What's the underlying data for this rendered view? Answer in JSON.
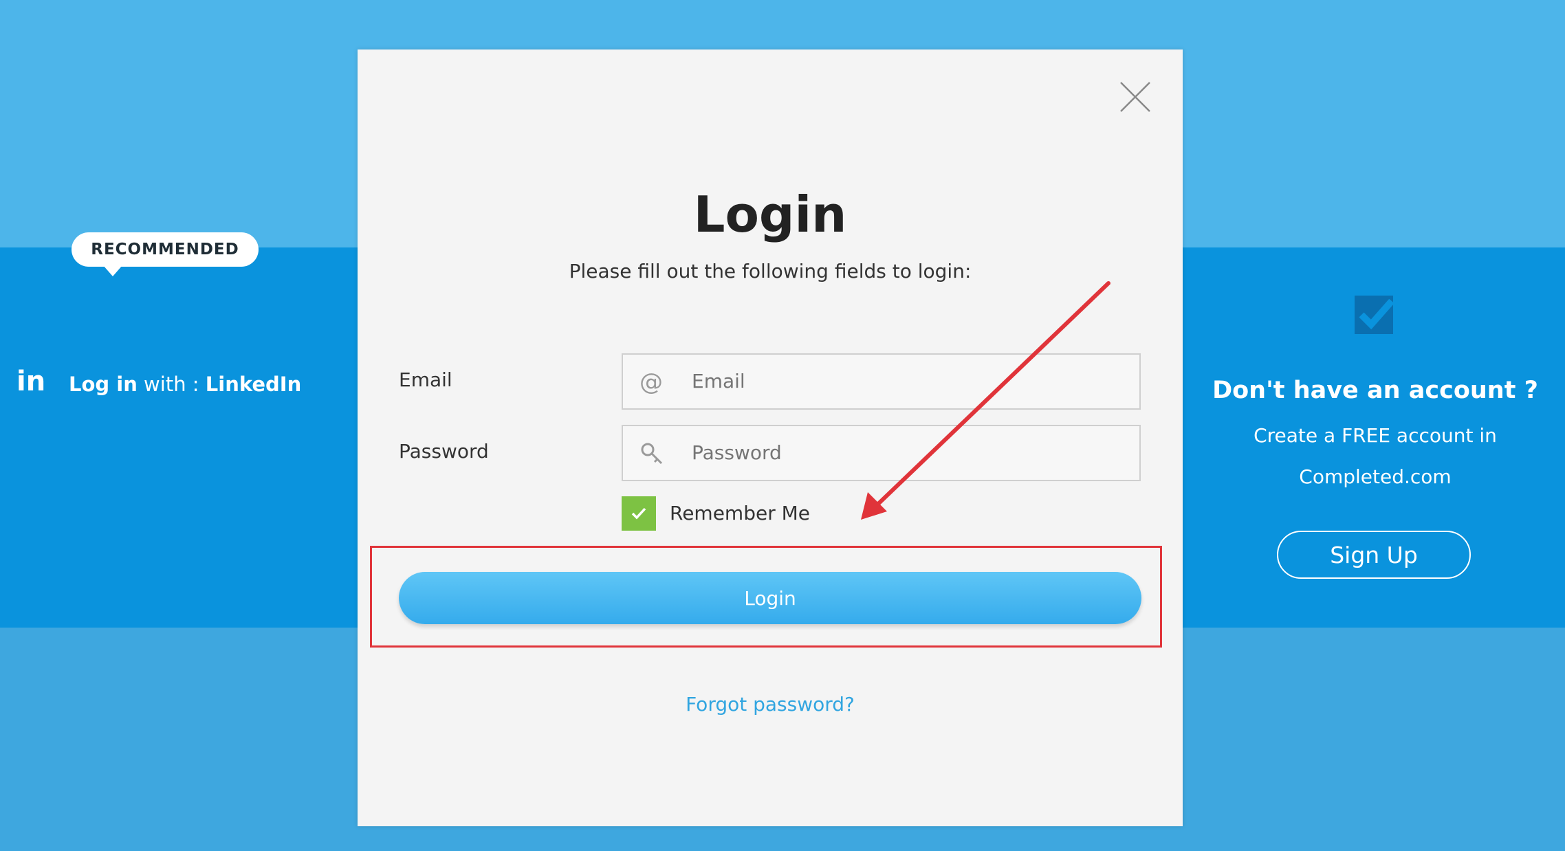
{
  "left_panel": {
    "badge": "RECOMMENDED",
    "linkedin_logo": "in",
    "login_bold": "Log in",
    "login_with": " with : ",
    "provider": "LinkedIn"
  },
  "right_panel": {
    "title": "Don't have an account ?",
    "subtitle_line1": "Create a FREE account in",
    "subtitle_line2": "Completed.com",
    "signup_label": "Sign Up",
    "icon": "checkmark-square-icon"
  },
  "modal": {
    "title": "Login",
    "subtitle": "Please fill out the following fields to login:",
    "email_label": "Email",
    "email_placeholder": "Email",
    "password_label": "Password",
    "password_placeholder": "Password",
    "remember_label": "Remember Me",
    "remember_checked": true,
    "login_label": "Login",
    "forgot_label": "Forgot password?",
    "close_icon": "close-icon"
  },
  "colors": {
    "background": "#4db5ea",
    "band": "#0a93dd",
    "login_button": "#3fb3f0",
    "checkbox": "#7dc243",
    "annotation": "#e0343a",
    "link": "#31a5e0"
  }
}
